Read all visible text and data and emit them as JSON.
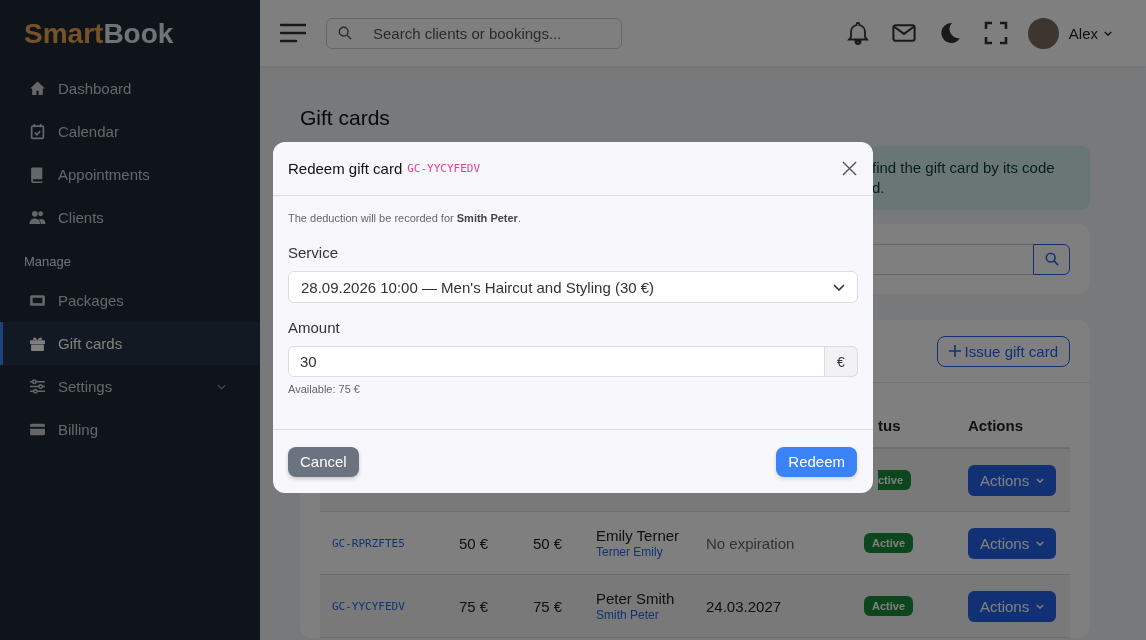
{
  "sidebar": {
    "logo": {
      "first": "Smart",
      "second": "Book"
    },
    "items": [
      {
        "kind": "item",
        "label": "Dashboard",
        "selected": false
      },
      {
        "kind": "item",
        "label": "Calendar",
        "selected": false
      },
      {
        "kind": "item",
        "label": "Appointments",
        "selected": false
      },
      {
        "kind": "item",
        "label": "Clients",
        "selected": false
      },
      {
        "kind": "heading",
        "label": "Manage"
      },
      {
        "kind": "item",
        "label": "Packages",
        "selected": false
      },
      {
        "kind": "item",
        "label": "Gift cards",
        "selected": true
      },
      {
        "kind": "group",
        "label": "Settings",
        "selected": false,
        "expanded": false
      },
      {
        "kind": "item",
        "label": "Billing",
        "selected": false
      }
    ]
  },
  "topbar": {
    "search": {
      "placeholder": "Search clients or bookings..."
    },
    "user": {
      "name": "Alex"
    }
  },
  "page": {
    "title": "Gift cards",
    "alert": {
      "lines": [
        "find the gift card by its code",
        "d."
      ]
    },
    "issue_button": "Issue gift card",
    "table": {
      "columns": [
        {
          "label": "tus"
        },
        {
          "label": "Actions"
        }
      ],
      "rows": [
        {
          "kind": "partial",
          "status": "ctive",
          "action": "Actions"
        },
        {
          "kind": "full",
          "code": "GC-RPRZFTE5",
          "balance": "50 €",
          "initial": "50 €",
          "client": "Emily Terner",
          "client_link": "Terner Emily",
          "expiry": "No expiration",
          "expiry_muted": true,
          "status": "Active",
          "action": "Actions"
        },
        {
          "kind": "full",
          "code": "GC-YYCYFEDV",
          "balance": "75 €",
          "initial": "75 €",
          "client": "Peter Smith",
          "client_link": "Smith Peter",
          "expiry": "24.03.2027",
          "expiry_muted": false,
          "status": "Active",
          "action": "Actions"
        }
      ]
    }
  },
  "modal": {
    "title": "Redeem gift card",
    "code": "GC-YYCYFEDV",
    "note": "The deduction will be recorded for **Smith Peter**.",
    "service": {
      "label": "Service",
      "value": "28.09.2026 10:00 — Men's Haircut and Styling (30 €)"
    },
    "amount": {
      "label": "Amount",
      "value": "30",
      "suffix": "€",
      "hint": "Available: 75 €"
    },
    "buttons": {
      "cancel": "Cancel",
      "confirm": "Redeem"
    }
  }
}
